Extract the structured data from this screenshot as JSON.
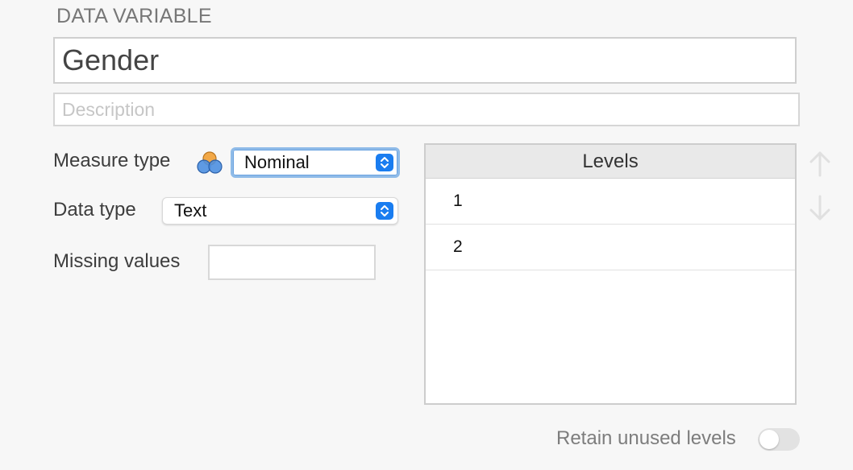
{
  "section": {
    "title": "DATA VARIABLE"
  },
  "variable": {
    "name": "Gender",
    "description_placeholder": "Description",
    "description_value": ""
  },
  "measure_type": {
    "label": "Measure type",
    "icon": "nominal-icon",
    "selected": "Nominal"
  },
  "data_type": {
    "label": "Data type",
    "selected": "Text"
  },
  "missing_values": {
    "label": "Missing values",
    "value": ""
  },
  "levels": {
    "header": "Levels",
    "items": [
      "1",
      "2"
    ],
    "move_up_icon": "arrow-up-icon",
    "move_down_icon": "arrow-down-icon"
  },
  "retain_unused": {
    "label": "Retain unused levels",
    "enabled": false
  },
  "colors": {
    "accent": "#1a7df0",
    "focus_ring": "#8fbbe8",
    "icon_orange": "#f2a847",
    "icon_blue": "#4d8fe0"
  }
}
